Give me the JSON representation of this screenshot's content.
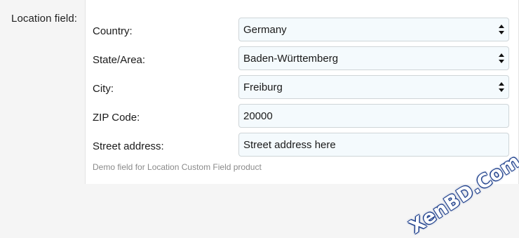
{
  "section": {
    "label": "Location field:"
  },
  "fields": {
    "country": {
      "label": "Country:",
      "value": "Germany"
    },
    "state": {
      "label": "State/Area:",
      "value": "Baden-Württemberg"
    },
    "city": {
      "label": "City:",
      "value": "Freiburg"
    },
    "zip": {
      "label": "ZIP Code:",
      "value": "20000"
    },
    "street": {
      "label": "Street address:",
      "value": "Street address here"
    }
  },
  "hint": "Demo field for Location Custom Field product",
  "watermark": "XenBD.Com"
}
